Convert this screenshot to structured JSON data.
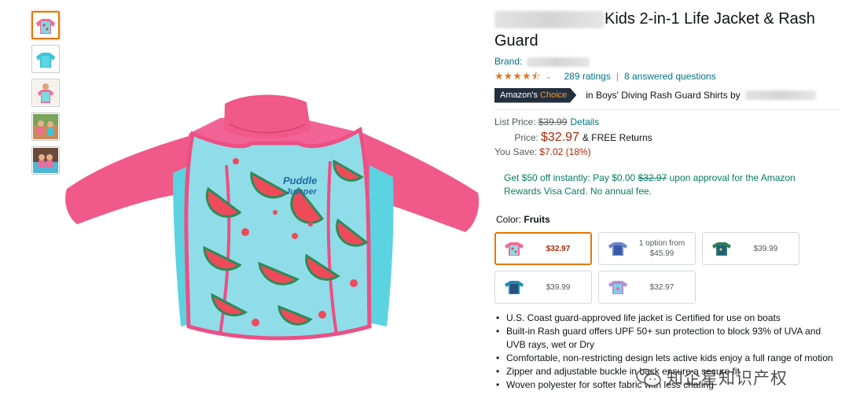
{
  "product": {
    "title": "Kids 2-in-1 Life Jacket & Rash Guard",
    "brand_label": "Brand:",
    "stars_display": "★★★★⯪",
    "rating": 4.5,
    "ratings_count": "289 ratings",
    "answered_questions": "8 answered questions",
    "choice_badge_prefix": "Amazon's",
    "choice_badge_accent": "Choice",
    "choice_category": "in Boys' Diving Rash Guard Shirts by"
  },
  "pricing": {
    "list_price_label": "List Price:",
    "list_price": "$39.99",
    "details_link": "Details",
    "price_label": "Price:",
    "price": "$32.97",
    "free_returns": "& FREE Returns",
    "save_label": "You Save:",
    "save_value": "$7.02 (18%)"
  },
  "promo": {
    "text_before": "Get $50 off instantly: Pay $0.00",
    "struck_price": "$32.97",
    "text_after": "upon approval for the Amazon Rewards Visa Card. No annual fee."
  },
  "color": {
    "label": "Color:",
    "selected": "Fruits"
  },
  "swatches": [
    {
      "price": "$32.97",
      "selected": true,
      "style": "fruits"
    },
    {
      "line1": "1 option from",
      "line2": "$45.99",
      "style": "blue-navy"
    },
    {
      "price": "$39.99",
      "style": "dino"
    },
    {
      "price": "$39.99",
      "style": "shark"
    },
    {
      "price": "$32.97",
      "style": "butterfly"
    }
  ],
  "bullets": [
    "U.S. Coast guard-approved life jacket is Certified for use on boats",
    "Built-in Rash guard offers UPF 50+ sun protection to block 93% of UVA and UVB rays, wet or Dry",
    "Comfortable, non-restricting design lets active kids enjoy a full range of motion",
    "Zipper and adjustable buckle in back ensure a secure fit",
    "Woven polyester for softer fabric with less chafing"
  ],
  "watermark": {
    "text": "知企星知识产权"
  },
  "image_text": {
    "brand_logo_line1": "Puddle",
    "brand_logo_line2": "Jumper"
  },
  "icons": {
    "rating": "star-icon",
    "dropdown": "chevron-down-icon",
    "watermark": "wechat-icon"
  },
  "colors": {
    "link": "#007185",
    "price": "#B12704",
    "star": "#DE7921",
    "badge_bg": "#232F3E",
    "badge_accent": "#F69931",
    "promo": "#067D62",
    "selected_border": "#E77600",
    "vest_pink": "#F05A8A",
    "vest_aqua": "#5CD3E0"
  }
}
